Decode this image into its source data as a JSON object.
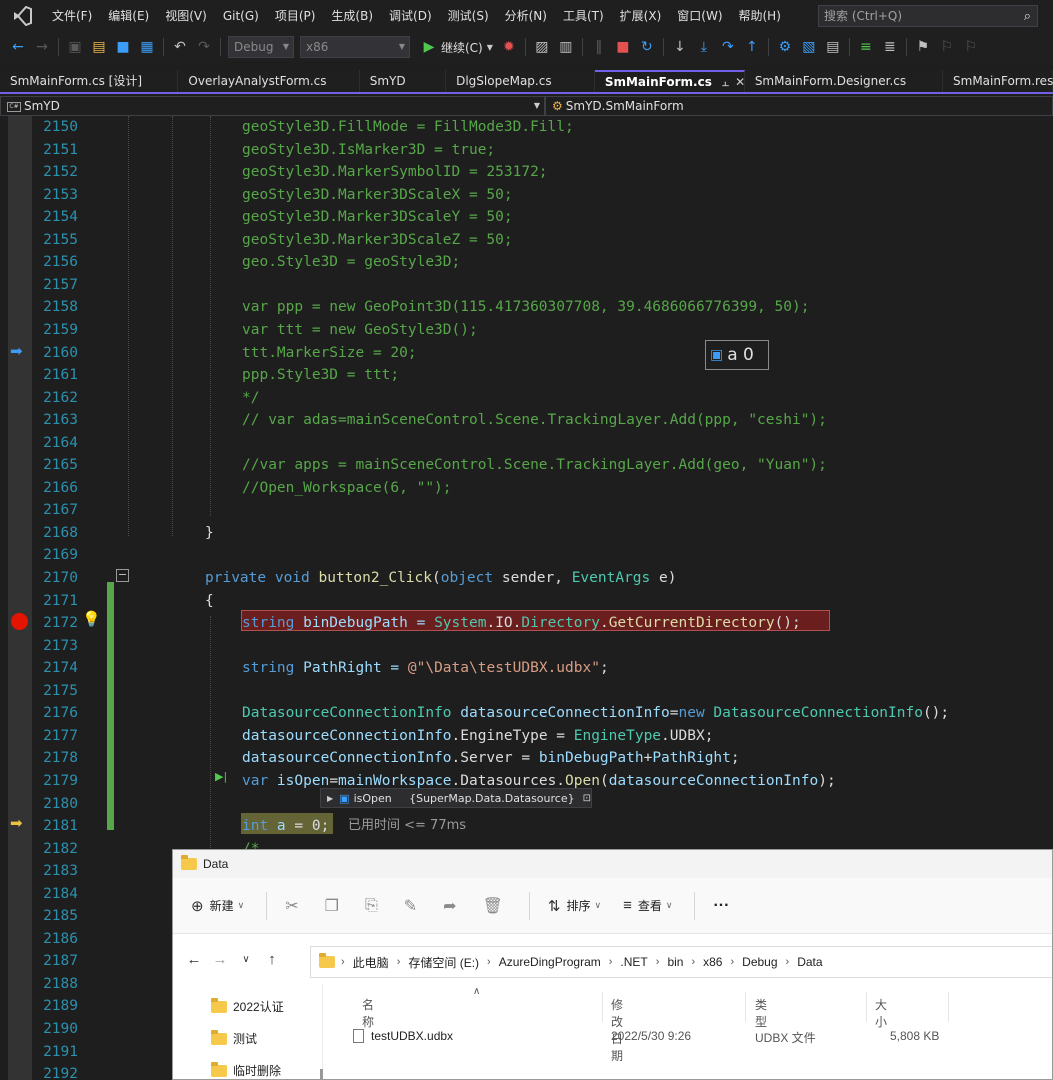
{
  "menubar": {
    "items": [
      "文件(F)",
      "编辑(E)",
      "视图(V)",
      "Git(G)",
      "项目(P)",
      "生成(B)",
      "调试(D)",
      "测试(S)",
      "分析(N)",
      "工具(T)",
      "扩展(X)",
      "窗口(W)",
      "帮助(H)"
    ],
    "search_placeholder": "搜索 (Ctrl+Q)"
  },
  "toolbar": {
    "config": "Debug",
    "platform": "x86",
    "continue_label": "继续(C)"
  },
  "tabs": [
    {
      "label": "SmMainForm.cs [设计]",
      "active": false
    },
    {
      "label": "OverlayAnalystForm.cs",
      "active": false
    },
    {
      "label": "SmYD",
      "active": false
    },
    {
      "label": "DlgSlopeMap.cs",
      "active": false
    },
    {
      "label": "SmMainForm.cs",
      "active": true
    },
    {
      "label": "SmMainForm.Designer.cs",
      "active": false
    },
    {
      "label": "SmMainForm.res",
      "active": false
    }
  ],
  "navbar": {
    "project": "SmYD",
    "class": "SmYD.SmMainForm"
  },
  "editor": {
    "line_numbers": [
      "2150",
      "2151",
      "2152",
      "2153",
      "2154",
      "2155",
      "2156",
      "2157",
      "2158",
      "2159",
      "2160",
      "2161",
      "2162",
      "2163",
      "2164",
      "2165",
      "2166",
      "2167",
      "2168",
      "2169",
      "2170",
      "2171",
      "2172",
      "2173",
      "2174",
      "2175",
      "2176",
      "2177",
      "2178",
      "2179",
      "2180",
      "2181",
      "2182",
      "2183",
      "2184",
      "2185",
      "2186",
      "2187",
      "2188",
      "2189",
      "2190",
      "2191",
      "2192"
    ],
    "lines": {
      "l2150": "geoStyle3D.FillMode = FillMode3D.Fill;",
      "l2151": "geoStyle3D.IsMarker3D = true;",
      "l2152": "geoStyle3D.MarkerSymbolID = 253172;",
      "l2153": "geoStyle3D.Marker3DScaleX = 50;",
      "l2154": "geoStyle3D.Marker3DScaleY = 50;",
      "l2155": "geoStyle3D.Marker3DScaleZ = 50;",
      "l2156": "geo.Style3D = geoStyle3D;",
      "l2158": "var ppp = new GeoPoint3D(115.417360307708, 39.4686066776399, 50);",
      "l2159": "var ttt = new GeoStyle3D();",
      "l2160": "ttt.MarkerSize = 20;",
      "l2161": "ppp.Style3D = ttt;",
      "l2162": "*/",
      "l2163": "// var adas=mainSceneControl.Scene.TrackingLayer.Add(ppp, \"ceshi\");",
      "l2165": "//var apps = mainSceneControl.Scene.TrackingLayer.Add(geo, \"Yuan\");",
      "l2166": "//Open_Workspace(6, \"\");",
      "l2168": "}",
      "l2170_kw1": "private",
      "l2170_kw2": "void",
      "l2170_fn": "button2_Click",
      "l2170_p1": "(",
      "l2170_kw3": "object",
      "l2170_p2": " sender, ",
      "l2170_ty": "EventArgs",
      "l2170_p3": " e)",
      "l2171": "{",
      "l2172_kw": "string",
      "l2172_var": " binDebugPath = ",
      "l2172_ty": "System",
      "l2172_rest": ".IO.",
      "l2172_ty2": "Directory",
      "l2172_dot": ".",
      "l2172_fn": "GetCurrentDirectory",
      "l2172_end": "();",
      "l2174_kw": "string",
      "l2174_var": " PathRight = ",
      "l2174_str": "@\"\\Data\\testUDBX.udbx\"",
      "l2174_end": ";",
      "l2176_ty": "DatasourceConnectionInfo",
      "l2176_var": " datasourceConnectionInfo",
      "l2176_eq": "=",
      "l2176_kw": "new",
      "l2176_ty2": " DatasourceConnectionInfo",
      "l2176_end": "();",
      "l2177_var": "datasourceConnectionInfo",
      "l2177_mid": ".EngineType = ",
      "l2177_ty": "EngineType",
      "l2177_end": ".UDBX;",
      "l2178_var": "datasourceConnectionInfo",
      "l2178_mid": ".Server = ",
      "l2178_var2": "binDebugPath",
      "l2178_plus": "+",
      "l2178_var3": "PathRight",
      "l2178_end": ";",
      "l2179_kw": "var",
      "l2179_var": " isOpen",
      "l2179_mid": "=",
      "l2179_var2": "mainWorkspace",
      "l2179_mid2": ".Datasources.",
      "l2179_fn": "Open",
      "l2179_p": "(",
      "l2179_var3": "datasourceConnectionInfo",
      "l2179_end": ");",
      "l2181_kw": "int",
      "l2181_var": " a",
      "l2181_rest": " = 0;",
      "l2181_elapsed": "已用时间 <= 77ms",
      "l2182": "/*"
    },
    "hover_tip": "a 0",
    "datatip": {
      "name": "isOpen",
      "value": "{SuperMap.Data.Datasource}"
    }
  },
  "explorer": {
    "title": "Data",
    "cmd_new": "新建",
    "cmd_sort": "排序",
    "cmd_view": "查看",
    "cmd_more": "···",
    "breadcrumb": [
      "此电脑",
      "存储空间 (E:)",
      "AzureDingProgram",
      ".NET",
      "bin",
      "x86",
      "Debug",
      "Data"
    ],
    "nav_folders": [
      "2022认证",
      "测试",
      "临时删除"
    ],
    "columns": {
      "name": "名称",
      "modified": "修改日期",
      "type": "类型",
      "size": "大小"
    },
    "files": [
      {
        "name": "testUDBX.udbx",
        "modified": "2022/5/30 9:26",
        "type": "UDBX 文件",
        "size": "5,808 KB"
      }
    ]
  }
}
